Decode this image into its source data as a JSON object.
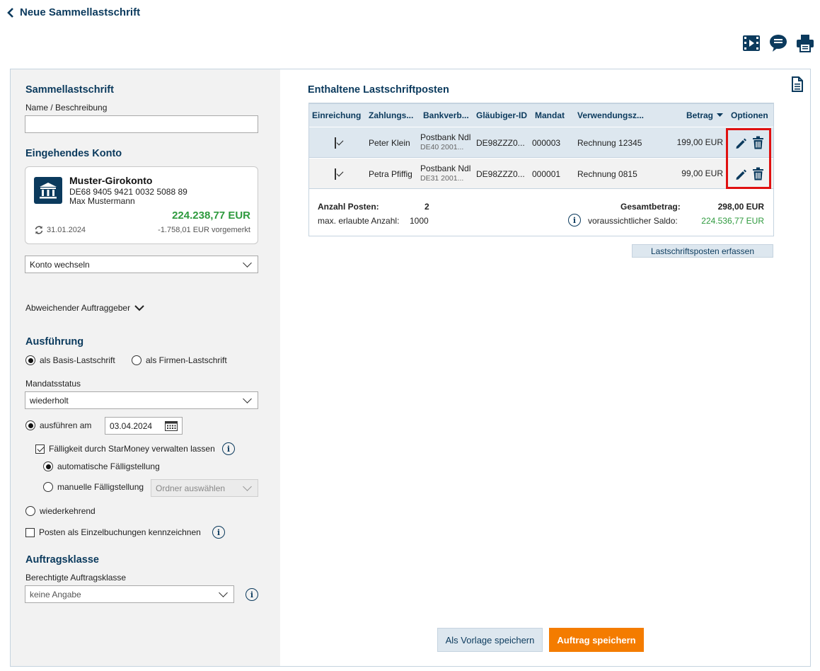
{
  "header": {
    "back_label": "Neue Sammellastschrift"
  },
  "left": {
    "section1": "Sammellastschrift",
    "name_label": "Name / Beschreibung",
    "name_value": "",
    "section2": "Eingehendes Konto",
    "account": {
      "name": "Muster-Girokonto",
      "iban": "DE68 9405 9421 0032 5088 89",
      "holder": "Max Mustermann",
      "balance": "224.238,77 EUR",
      "date": "31.01.2024",
      "reserved": "-1.758,01 EUR vorgemerkt"
    },
    "switch_account": "Konto wechseln",
    "different_orderer": "Abweichender Auftraggeber",
    "section3": "Ausführung",
    "radio_basis": "als Basis-Lastschrift",
    "radio_firmen": "als Firmen-Lastschrift",
    "mandate_label": "Mandatsstatus",
    "mandate_value": "wiederholt",
    "execute_on": "ausführen am",
    "execute_date": "03.04.2024",
    "due_manage": "Fälligkeit durch StarMoney verwalten lassen",
    "auto_due": "automatische Fälligstellung",
    "manual_due": "manuelle Fälligstellung",
    "folder_placeholder": "Ordner auswählen",
    "recurring": "wiederkehrend",
    "single_booking": "Posten als Einzelbuchungen kennzeichnen",
    "section4": "Auftragsklasse",
    "class_label": "Berechtigte Auftragsklasse",
    "class_value": "keine Angabe"
  },
  "right": {
    "title": "Enthaltene Lastschriftposten",
    "columns": [
      "Einreichung",
      "Zahlungs...",
      "Bankverb...",
      "Gläubiger-ID",
      "Mandat",
      "Verwendungsz...",
      "Betrag",
      "Optionen"
    ],
    "rows": [
      {
        "name": "Peter Klein",
        "bank": "Postbank Ndl",
        "bank_sub": "DE40 2001...",
        "creditor": "DE98ZZZ0...",
        "mandate": "000003",
        "purpose": "Rechnung 12345",
        "amount": "199,00 EUR"
      },
      {
        "name": "Petra Pfiffig",
        "bank": "Postbank Ndl",
        "bank_sub": "DE31 2001...",
        "creditor": "DE98ZZZ0...",
        "mandate": "000001",
        "purpose": "Rechnung 0815",
        "amount": "99,00 EUR"
      }
    ],
    "count_label": "Anzahl Posten:",
    "count_value": "2",
    "max_label": "max. erlaubte Anzahl:",
    "max_value": "1000",
    "total_label": "Gesamtbetrag:",
    "total_value": "298,00 EUR",
    "saldo_label": "voraussichtlicher Saldo:",
    "saldo_value": "224.536,77 EUR",
    "add_button": "Lastschriftsposten erfassen",
    "template_button": "Als Vorlage speichern",
    "save_button": "Auftrag speichern"
  },
  "colors": {
    "navy": "#0b3a5d",
    "green": "#2e9a3e",
    "orange": "#f47c00",
    "highlight": "#e01010"
  }
}
